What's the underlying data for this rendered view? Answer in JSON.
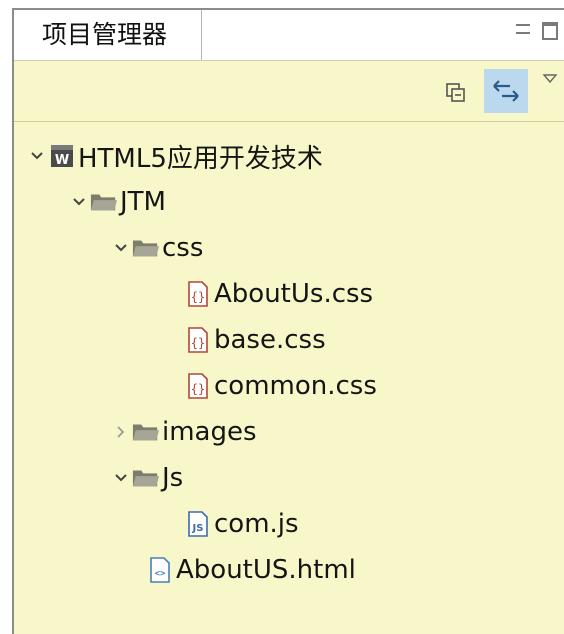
{
  "panel": {
    "tab_title": "项目管理器"
  },
  "toolbar": {
    "buttons": [
      "collapse-all-icon",
      "link-with-editor-icon",
      "view-menu-icon"
    ]
  },
  "colors": {
    "background": "#f8f7c9",
    "link_button_active": "#bcd8ef",
    "folder": "#8a8a7a",
    "css_file": "#b2463a",
    "js_file": "#3c6bb0",
    "html_file": "#4a7fb8"
  },
  "tree": {
    "project": {
      "label": "HTML5应用开发技术",
      "expanded": true,
      "icon": "web-project-icon"
    },
    "jtm": {
      "label": "JTM",
      "expanded": true,
      "icon": "folder-icon"
    },
    "css": {
      "label": "css",
      "expanded": true,
      "icon": "folder-icon"
    },
    "css_files": [
      "AboutUs.css",
      "base.css",
      "common.css"
    ],
    "images": {
      "label": "images",
      "expanded": false,
      "icon": "folder-icon"
    },
    "js": {
      "label": "Js",
      "expanded": true,
      "icon": "folder-icon"
    },
    "js_files": [
      "com.js"
    ],
    "html_files": [
      "AboutUS.html"
    ]
  }
}
